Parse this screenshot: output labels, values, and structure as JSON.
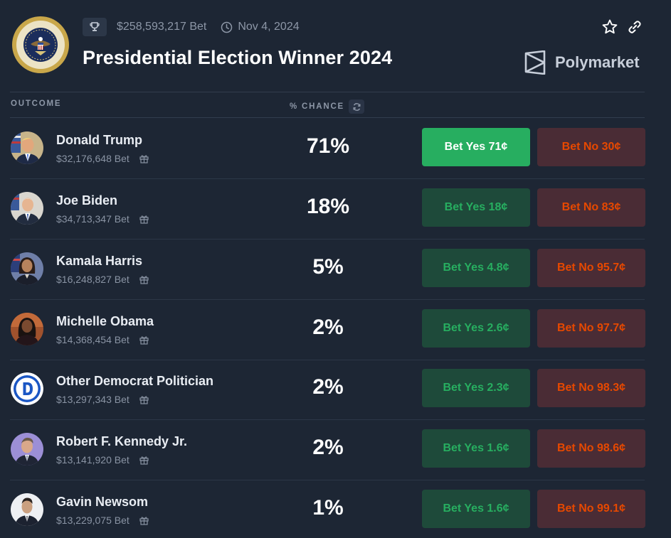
{
  "header": {
    "title": "Presidential Election Winner 2024",
    "volume": "$258,593,217 Bet",
    "date": "Nov 4, 2024",
    "brand": "Polymarket",
    "icons": {
      "trophy": "trophy-icon",
      "clock": "clock-icon",
      "star": "star-icon",
      "link": "link-icon",
      "brand": "polymarket-logo-icon"
    }
  },
  "columns": {
    "outcome": "OUTCOME",
    "chance": "% CHANCE"
  },
  "colors": {
    "background": "#1d2634",
    "yes_active": "#27ae60",
    "yes_text": "#27ae60",
    "yes_bg": "#1e4a3a",
    "no_text": "#e64800",
    "no_bg": "#4a2c35"
  },
  "outcomes": [
    {
      "name": "Donald Trump",
      "bet": "$32,176,648 Bet",
      "chance": "71%",
      "yes": "Bet Yes 71¢",
      "no": "Bet No 30¢",
      "active": true
    },
    {
      "name": "Joe Biden",
      "bet": "$34,713,347 Bet",
      "chance": "18%",
      "yes": "Bet Yes 18¢",
      "no": "Bet No 83¢",
      "active": false
    },
    {
      "name": "Kamala Harris",
      "bet": "$16,248,827 Bet",
      "chance": "5%",
      "yes": "Bet Yes 4.8¢",
      "no": "Bet No 95.7¢",
      "active": false
    },
    {
      "name": "Michelle Obama",
      "bet": "$14,368,454 Bet",
      "chance": "2%",
      "yes": "Bet Yes 2.6¢",
      "no": "Bet No 97.7¢",
      "active": false
    },
    {
      "name": "Other Democrat Politician",
      "bet": "$13,297,343 Bet",
      "chance": "2%",
      "yes": "Bet Yes 2.3¢",
      "no": "Bet No 98.3¢",
      "active": false
    },
    {
      "name": "Robert F. Kennedy Jr.",
      "bet": "$13,141,920 Bet",
      "chance": "2%",
      "yes": "Bet Yes 1.6¢",
      "no": "Bet No 98.6¢",
      "active": false
    },
    {
      "name": "Gavin Newsom",
      "bet": "$13,229,075 Bet",
      "chance": "1%",
      "yes": "Bet Yes 1.6¢",
      "no": "Bet No 99.1¢",
      "active": false
    }
  ]
}
